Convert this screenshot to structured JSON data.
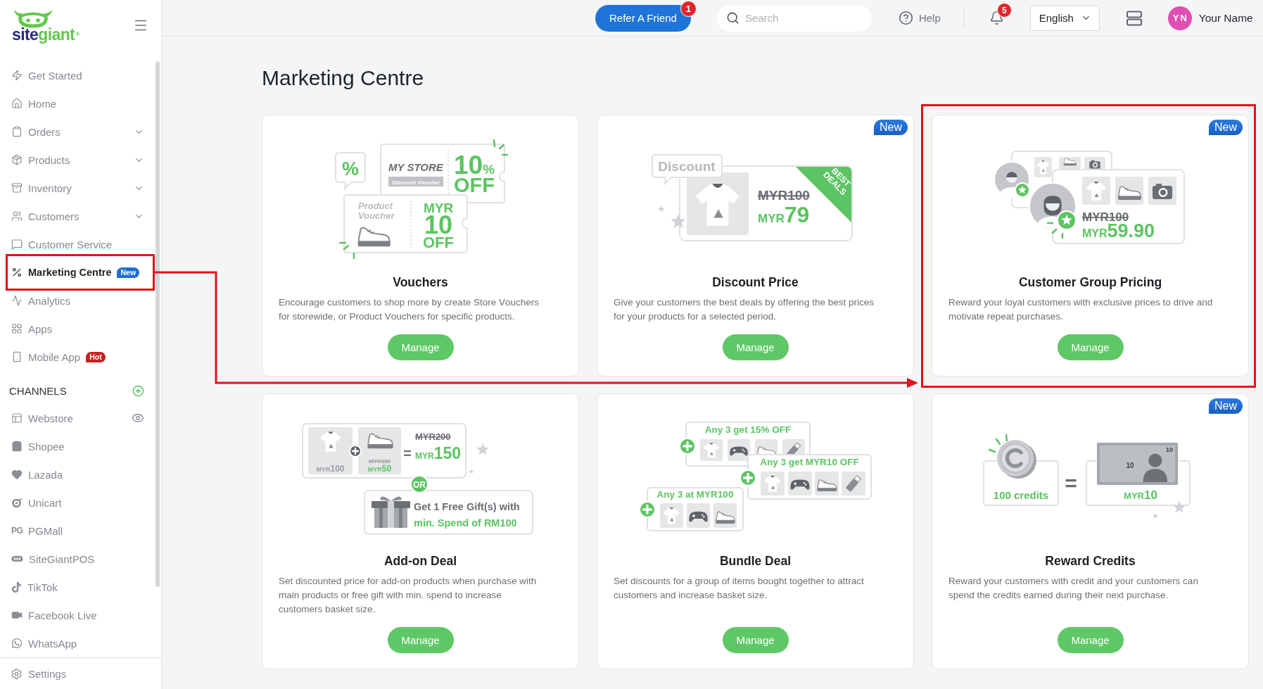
{
  "logo": {
    "word_1": "site",
    "word_2": "giant",
    "mark": "®"
  },
  "sidebar": {
    "menu_items": [
      {
        "label": "Get Started",
        "kind": "link",
        "selected": false,
        "highlighted": false
      },
      {
        "label": "Home",
        "kind": "link",
        "selected": false,
        "highlighted": false
      },
      {
        "label": "Orders",
        "kind": "group",
        "selected": false,
        "highlighted": false
      },
      {
        "label": "Products",
        "kind": "group",
        "selected": false,
        "highlighted": false
      },
      {
        "label": "Inventory",
        "kind": "group",
        "selected": false,
        "highlighted": false
      },
      {
        "label": "Customers",
        "kind": "group",
        "selected": false,
        "highlighted": false
      },
      {
        "label": "Customer Service",
        "kind": "link",
        "selected": false,
        "highlighted": false
      },
      {
        "label": "Marketing Centre",
        "kind": "link",
        "selected": true,
        "highlighted": true,
        "badge": {
          "text": "New",
          "kind": "new"
        }
      },
      {
        "label": "Analytics",
        "kind": "link",
        "selected": false,
        "highlighted": false
      },
      {
        "label": "Apps",
        "kind": "link",
        "selected": false,
        "highlighted": false
      },
      {
        "label": "Mobile App",
        "kind": "link",
        "selected": false,
        "highlighted": false,
        "badge": {
          "text": "Hot",
          "kind": "hot"
        }
      }
    ],
    "channels": {
      "title": "CHANNELS",
      "items": [
        {
          "label": "Webstore",
          "kind": "preview"
        },
        {
          "label": "Shopee",
          "kind": "plain"
        },
        {
          "label": "Lazada",
          "kind": "plain"
        },
        {
          "label": "Unicart",
          "kind": "plain"
        },
        {
          "label": "PGMall",
          "kind": "plain",
          "logo_text": "PG"
        },
        {
          "label": "SiteGiantPOS",
          "kind": "plain"
        },
        {
          "label": "TikTok",
          "kind": "plain"
        },
        {
          "label": "Facebook Live",
          "kind": "plain"
        },
        {
          "label": "WhatsApp",
          "kind": "plain"
        }
      ]
    },
    "footer": {
      "label": "Settings"
    }
  },
  "topbar": {
    "refer_button": {
      "label": "Refer A Friend",
      "badge": "1"
    },
    "search": {
      "placeholder": "Search"
    },
    "help": {
      "label": "Help"
    },
    "notifications": {
      "badge": "5"
    },
    "language": {
      "value": "English"
    },
    "user": {
      "initials": "YN",
      "name": "Your Name"
    }
  },
  "page": {
    "title": "Marketing Centre"
  },
  "cards": [
    {
      "title": "Vouchers",
      "description": "Encourage customers to shop more by create Store Vouchers for storewide, or Product Vouchers for specific products.",
      "button": "Manage",
      "highlighted": false,
      "illustration": {
        "kind": "vouchers",
        "badge_symbol": "%",
        "store_name": "MY STORE",
        "store_label": "Discount Voucher",
        "store_amount": "10",
        "store_unit": "%",
        "store_off": "OFF",
        "product_lines": [
          "Product",
          "Voucher"
        ],
        "product_currency": "MYR",
        "product_amount": "10",
        "product_off": "OFF"
      }
    },
    {
      "title": "Discount Price",
      "badge": "New",
      "description": "Give your customers the best deals by offering the best prices for your products for a selected period.",
      "button": "Manage",
      "highlighted": false,
      "illustration": {
        "kind": "discount",
        "bubble": "Discount",
        "old_price": "MYR100",
        "new_currency": "MYR",
        "new_amount": "79",
        "ribbon_lines": [
          "BEST",
          "DEALS"
        ]
      }
    },
    {
      "title": "Customer Group Pricing",
      "badge": "New",
      "description": "Reward your loyal customers with exclusive prices to drive and motivate repeat purchases.",
      "button": "Manage",
      "highlighted": true,
      "illustration": {
        "kind": "group_pricing",
        "old_price": "MYR100",
        "new_currency": "MYR",
        "new_amount": "59.90"
      }
    },
    {
      "title": "Add-on Deal",
      "description": "Set discounted price for add-on products when purchase with main products or free gift with min. spend to increase customers basket size.",
      "button": "Manage",
      "highlighted": false,
      "illustration": {
        "kind": "add_on",
        "main_price": {
          "currency": "MYR",
          "amount": "100"
        },
        "addon_old_price": "MYR100",
        "addon_price": {
          "currency": "MYR",
          "amount": "50"
        },
        "equals": "=",
        "total_old": "MYR200",
        "total_new": {
          "currency": "MYR",
          "amount": "150"
        },
        "or": "OR",
        "gift_lines": [
          "Get 1 Free Gift(s) with",
          "min. Spend of RM100"
        ]
      }
    },
    {
      "title": "Bundle Deal",
      "description": "Set discounts for a group of items bought together to attract customers and increase basket size.",
      "button": "Manage",
      "highlighted": false,
      "illustration": {
        "kind": "bundle",
        "offers": [
          "Any 3 get 15% OFF",
          "Any 3 get MYR10 OFF",
          "Any 3 at MYR100"
        ]
      }
    },
    {
      "title": "Reward Credits",
      "badge": "New",
      "description": "Reward your customers with credit and your customers can spend the credits earned during their next purchase.",
      "button": "Manage",
      "highlighted": false,
      "illustration": {
        "kind": "reward",
        "credits": "100 credits",
        "equals": "=",
        "note_labels": [
          "10",
          "10"
        ],
        "cash": {
          "currency": "MYR",
          "amount": "10"
        }
      }
    }
  ]
}
